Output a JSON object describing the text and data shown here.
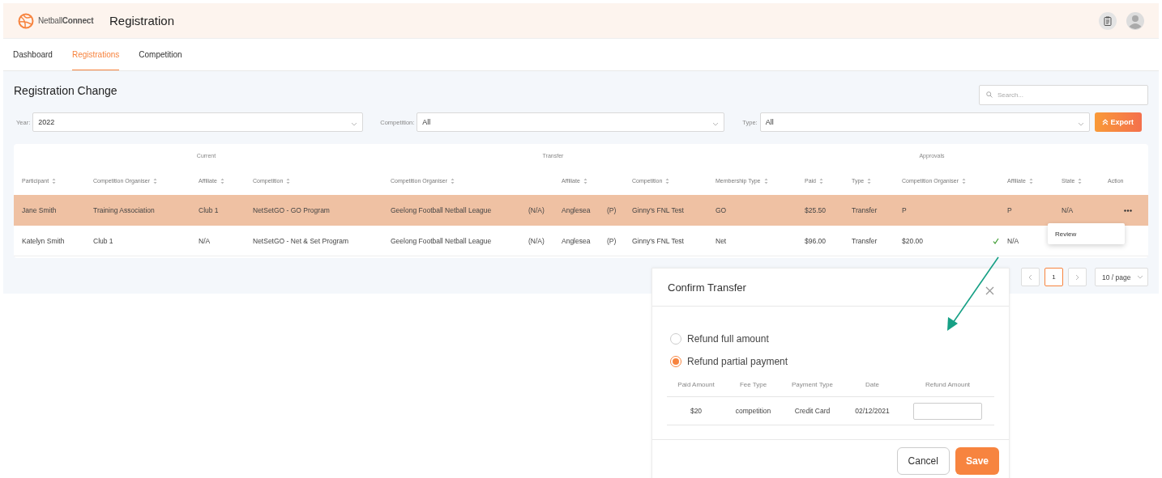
{
  "header": {
    "logo": "Netball**Connect**",
    "title": "Registration"
  },
  "nav": [
    {
      "label": "Dashboard",
      "selected": false
    },
    {
      "label": "Registrations",
      "selected": true
    },
    {
      "label": "Competition",
      "selected": false
    }
  ],
  "page_title": "Registration Change",
  "search": {
    "placeholder": "Search..."
  },
  "filters": [
    {
      "label": "Year:",
      "value": "2022"
    },
    {
      "label": "Competition:",
      "value": "All"
    },
    {
      "label": "Type:",
      "value": "All"
    }
  ],
  "export_button": "Export",
  "table": {
    "groups": [
      "Current",
      "Transfer",
      "Approvals"
    ],
    "columns": [
      {
        "label": "Participant",
        "kind": "sortable"
      },
      {
        "label": "Competition Organiser",
        "kind": "sortable"
      },
      {
        "label": "Affiliate",
        "kind": "sortable"
      },
      {
        "label": "Competition",
        "kind": "sortable"
      },
      {
        "label": "Competition Organiser",
        "kind": "sortable"
      },
      {
        "kind": "blank"
      },
      {
        "label": "Affiliate",
        "kind": "sortable"
      },
      {
        "kind": "blank"
      },
      {
        "label": "Competition",
        "kind": "sortable"
      },
      {
        "label": "Membership Type",
        "kind": "sortable"
      },
      {
        "label": "Paid",
        "kind": "sortable"
      },
      {
        "label": "Type",
        "kind": "sortable"
      },
      {
        "label": "Competition Organiser",
        "kind": "sortable"
      },
      {
        "label": "Affiliate",
        "kind": "sortable"
      },
      {
        "label": "State",
        "kind": "sortable"
      },
      {
        "label": "Action",
        "kind": "plain"
      }
    ],
    "rows": [
      {
        "selected": true,
        "approved": false,
        "actions_visible": true,
        "cells": [
          "Jane Smith",
          "Training Association",
          "Club 1",
          "NetSetGO - GO Program",
          "Geelong Football Netball League",
          "(N/A)",
          "Anglesea",
          "(P)",
          "Ginny's FNL Test",
          "GO",
          "$25.50",
          "Transfer",
          "P",
          "P",
          "N/A"
        ]
      },
      {
        "selected": false,
        "approved": true,
        "actions_visible": false,
        "cells": [
          "Katelyn Smith",
          "Club 1",
          "N/A",
          "NetSetGO - Net & Set Program",
          "Geelong Football Netball League",
          "(N/A)",
          "Anglesea",
          "(P)",
          "Ginny's FNL Test",
          "Net",
          "$96.00",
          "Transfer",
          "$20.00",
          "N/A"
        ]
      }
    ]
  },
  "row_menu": {
    "items": [
      "Review"
    ]
  },
  "pagination": {
    "pages": [
      {
        "label": "1",
        "selected": true
      }
    ],
    "page_size": "10 / page"
  },
  "modal": {
    "title": "Confirm Transfer",
    "options": [
      {
        "label": "Refund full amount",
        "selected": false
      },
      {
        "label": "Refund partial payment",
        "selected": true
      }
    ],
    "table": {
      "columns": [
        "Paid Amount",
        "Fee Type",
        "Payment Type",
        "Date",
        "Refund Amount"
      ],
      "rows": [
        {
          "cells": [
            "$20",
            "competition",
            "Credit Card",
            "02/12/2021"
          ]
        }
      ]
    },
    "buttons": [
      {
        "label": "Cancel",
        "kind": "secondary"
      },
      {
        "label": "Save",
        "kind": "primary"
      }
    ]
  }
}
